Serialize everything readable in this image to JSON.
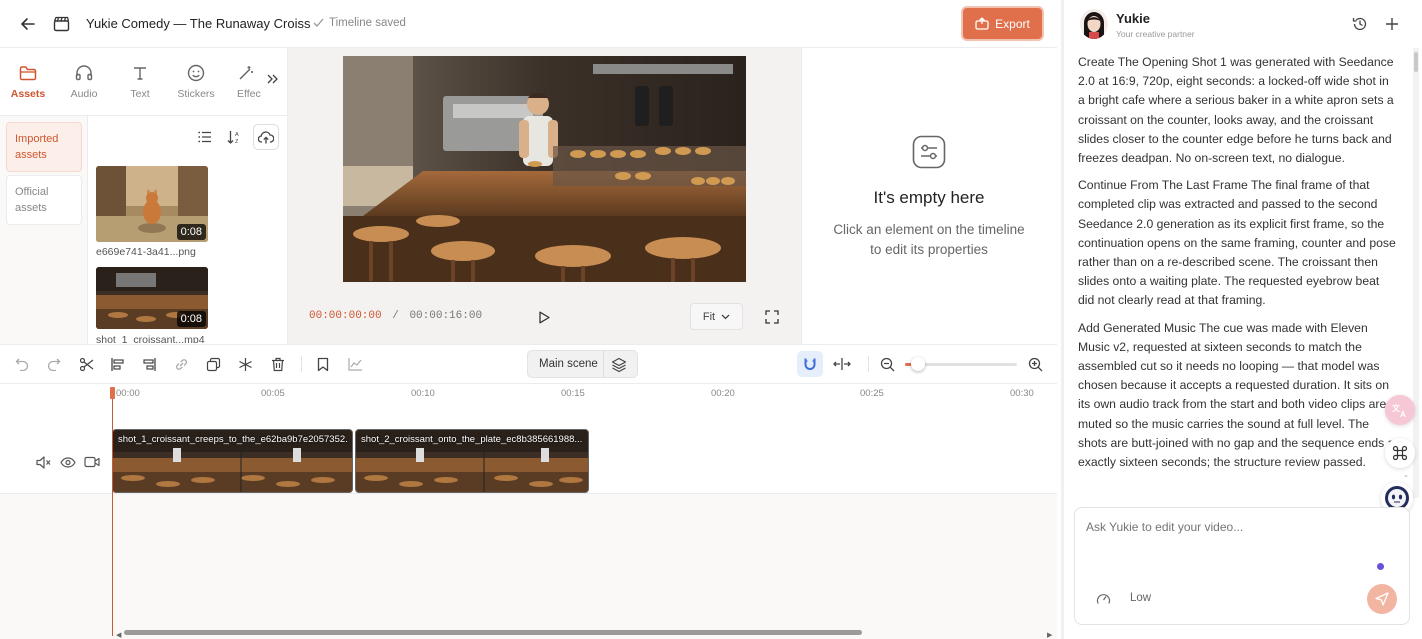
{
  "header": {
    "project_title": "Yukie Comedy — The Runaway Croiss",
    "save_status": "Timeline saved",
    "export_label": "Export"
  },
  "asset_tabs": [
    {
      "label": "Assets",
      "icon": "folder-icon",
      "active": true
    },
    {
      "label": "Audio",
      "icon": "headphones-icon",
      "active": false
    },
    {
      "label": "Text",
      "icon": "text-icon",
      "active": false
    },
    {
      "label": "Stickers",
      "icon": "smiley-icon",
      "active": false
    },
    {
      "label": "Effec",
      "icon": "magic-wand-icon",
      "active": false
    }
  ],
  "asset_categories": [
    {
      "label": "Imported assets",
      "active": true
    },
    {
      "label": "Official assets",
      "active": false
    }
  ],
  "assets": [
    {
      "name": "e669e741-3a41...png",
      "duration": "0:08"
    },
    {
      "name": "shot_1_croissant...mp4",
      "duration": "0:08"
    }
  ],
  "player": {
    "current_time": "00:00:00:00",
    "separator": "/",
    "total_time": "00:00:16:00",
    "fit_label": "Fit"
  },
  "properties": {
    "empty_title": "It's empty here",
    "empty_subtitle": "Click an element on the timeline to edit its properties"
  },
  "timeline": {
    "scene_label": "Main scene",
    "ruler_ticks": [
      "00:00",
      "00:05",
      "00:10",
      "00:15",
      "00:20",
      "00:25",
      "00:30"
    ],
    "clips": [
      {
        "name": "shot_1_croissant_creeps_to_the_e62ba9b7e2057352..."
      },
      {
        "name": "shot_2_croissant_onto_the_plate_ec8b385661988..."
      }
    ],
    "zoom_fraction": 0.12
  },
  "chat": {
    "assistant_name": "Yukie",
    "assistant_tagline": "Your creative partner",
    "messages": [
      "Create The Opening Shot 1 was generated with Seedance 2.0 at 16:9, 720p, eight seconds: a locked-off wide shot in a bright cafe where a serious baker in a white apron sets a croissant on the counter, looks away, and the croissant slides closer to the counter edge before he turns back and freezes deadpan. No on-screen text, no dialogue.",
      "Continue From The Last Frame The final frame of that completed clip was extracted and passed to the second Seedance 2.0 generation as its explicit first frame, so the continuation opens on the same framing, counter and pose rather than on a re-described scene. The croissant then slides onto a waiting plate. The requested eyebrow beat did not clearly read at that framing.",
      "Add Generated Music The cue was made with Eleven Music v2, requested at sixteen seconds to match the assembled cut so it needs no looping — that model was chosen because it accepts a requested duration. It sits on its own audio track from the start and both video clips are muted so the music carries the sound at full level. The shots are butt-joined with no gap and the sequence ends at exactly sixteen seconds; the structure review passed."
    ],
    "input_placeholder": "Ask Yukie to edit your video...",
    "quality_label": "Low"
  },
  "colors": {
    "accent": "#e06f4c",
    "accent_text": "#d0562f"
  }
}
